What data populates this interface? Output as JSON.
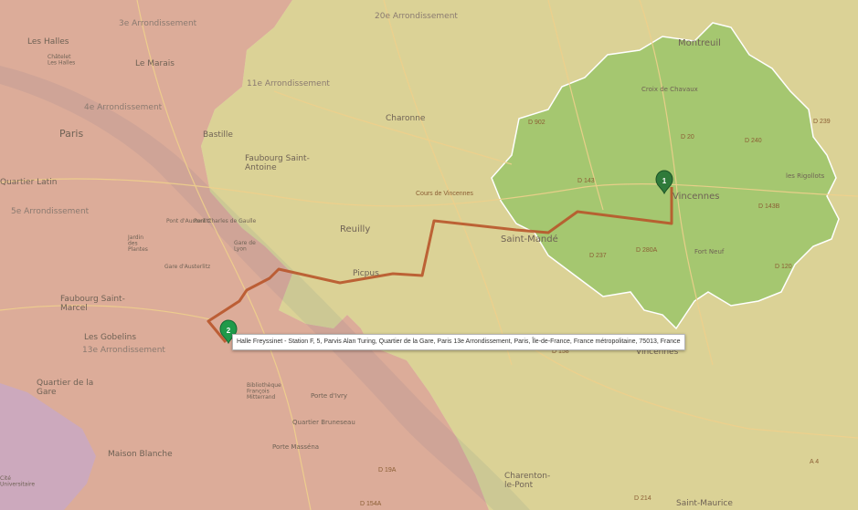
{
  "map": {
    "tooltip": "Halle Freyssinet - Station F, 5, Parvis Alan Turing, Quartier de la Gare, Paris 13e Arrondissement, Paris, Île-de-France, France métropolitaine, 75013, France",
    "markers": [
      {
        "label": "1",
        "color": "#2f7a3a"
      },
      {
        "label": "2",
        "color": "#1f9a4a"
      }
    ],
    "colors": {
      "zone_inner": "#9bc66a",
      "zone_middle": "#d4cb7a",
      "zone_outer": "#d79a84",
      "route": "#b8552a",
      "base": "#e9e3d6"
    },
    "places": {
      "les_halles": "Les Halles",
      "chatelet": "Châtelet\nLes Halles",
      "arr3": "3e Arrondissement",
      "le_marais": "Le Marais",
      "arr4": "4e Arrondissement",
      "paris": "Paris",
      "arr20": "20e Arrondissement",
      "arr11": "11e Arrondissement",
      "charonne": "Charonne",
      "bastille": "Bastille",
      "faubourg_st_antoine": "Faubourg Saint-\nAntoine",
      "reuilly": "Reuilly",
      "picpus": "Picpus",
      "saint_mande": "Saint-Mandé",
      "vincennes": "Vincennes",
      "montreuil": "Montreuil",
      "croix_chavaux": "Croix de Chavaux",
      "les_rigollots": "les Rigollots",
      "fort_neuf": "Fort Neuf",
      "bois_vincennes": "Bois de\nVincennes",
      "quartier_latin": "Quartier Latin",
      "arr5": "5e Arrondissement",
      "jardin_plantes": "Jardin\ndes\nPlantes",
      "faubourg_st_marcel": "Faubourg Saint-\nMarcel",
      "les_gobelins": "Les Gobelins",
      "arr13": "13e Arrondissement",
      "gare_lyon": "Gare de\nLyon",
      "gare_austerlitz": "Gare d'Austerlitz",
      "bibliotheque": "Bibliothèque\nFrançois\nMitterrand",
      "quartier_gare": "Quartier de la\nGare",
      "porte_ivry": "Porte d'Ivry",
      "quartier_bruneseau": "Quartier Bruneseau",
      "porte_massena": "Porte Masséna",
      "maison_blanche": "Maison Blanche",
      "charenton": "Charenton-\nle-Pont",
      "saint_maurice": "Saint-Maurice",
      "port_chas": "Pont Charles de Gaulle",
      "pont_austerlitz": "Pont d'Austerlitz",
      "cite_universitaire": "Cité\nUniversitaire"
    },
    "roads": {
      "d143": "D 143",
      "d239": "D 239",
      "d240": "D 240",
      "d20": "D 20",
      "d143b": "D 143B",
      "d237": "D 237",
      "d280a": "D 280A",
      "d120": "D 120",
      "d158": "D 158",
      "d19a": "D 19A",
      "d154a": "D 154A",
      "d214": "D 214",
      "a4": "A 4",
      "d902": "D 902",
      "cours_vincennes": "Cours de Vincennes"
    }
  }
}
